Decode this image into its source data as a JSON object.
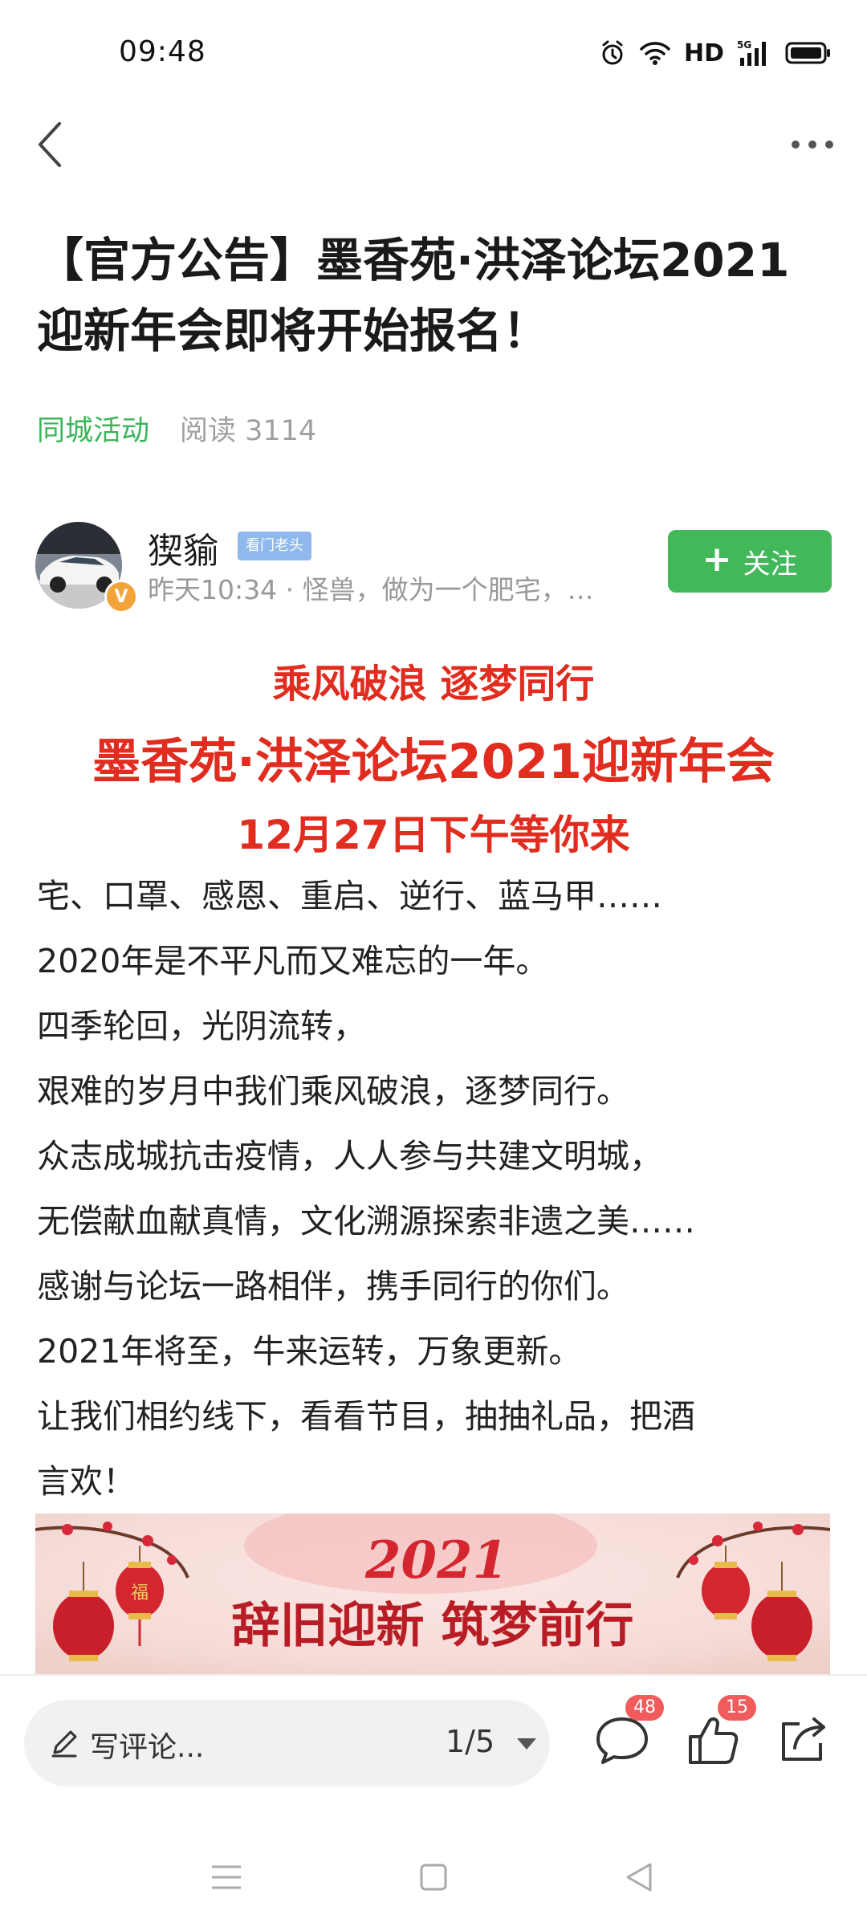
{
  "status_bar": {
    "time": "09:48",
    "network": "HD",
    "network_5g": "5G"
  },
  "article": {
    "title": "【官方公告】墨香苑·洪泽论坛2021迎新年会即将开始报名！",
    "category": "同城活动",
    "read_count": "阅读 3114"
  },
  "author": {
    "name": "猰貐",
    "badge": "看门老头",
    "verified_mark": "V",
    "subtitle": "昨天10:34 · 怪兽，做为一个肥宅，…",
    "follow_label": "关注",
    "follow_plus": "+"
  },
  "headlines": {
    "line1": "乘风破浪 逐梦同行",
    "line2": "墨香苑·洪泽论坛2021迎新年会",
    "line3": "12月27日下午等你来"
  },
  "body_lines": [
    "宅、口罩、感恩、重启、逆行、蓝马甲……",
    "2020年是不平凡而又难忘的一年。",
    "四季轮回，光阴流转，",
    "艰难的岁月中我们乘风破浪，逐梦同行。",
    "众志成城抗击疫情，人人参与共建文明城，",
    "无偿献血献真情，文化溯源探索非遗之美……",
    "感谢与论坛一路相伴，携手同行的你们。",
    "2021年将至，牛来运转，万象更新。",
    "让我们相约线下，看看节目，抽抽礼品，把酒",
    "言欢！"
  ],
  "banner": {
    "year": "2021",
    "slogan": "辞旧迎新 筑梦前行",
    "lantern_char": "福"
  },
  "bottom_bar": {
    "comment_placeholder": "写评论...",
    "pager": "1/5",
    "comment_count": "48",
    "like_count": "15"
  },
  "colors": {
    "accent_green": "#43b85a",
    "headline_red": "#e02d1f",
    "badge_red": "#f15b5b"
  },
  "icons": [
    "back-icon",
    "more-icon",
    "alarm-icon",
    "wifi-icon",
    "signal-icon",
    "battery-icon",
    "pencil-icon",
    "dropdown-arrow-icon",
    "comment-icon",
    "like-icon",
    "share-icon",
    "menu-icon",
    "home-icon",
    "nav-back-icon"
  ]
}
